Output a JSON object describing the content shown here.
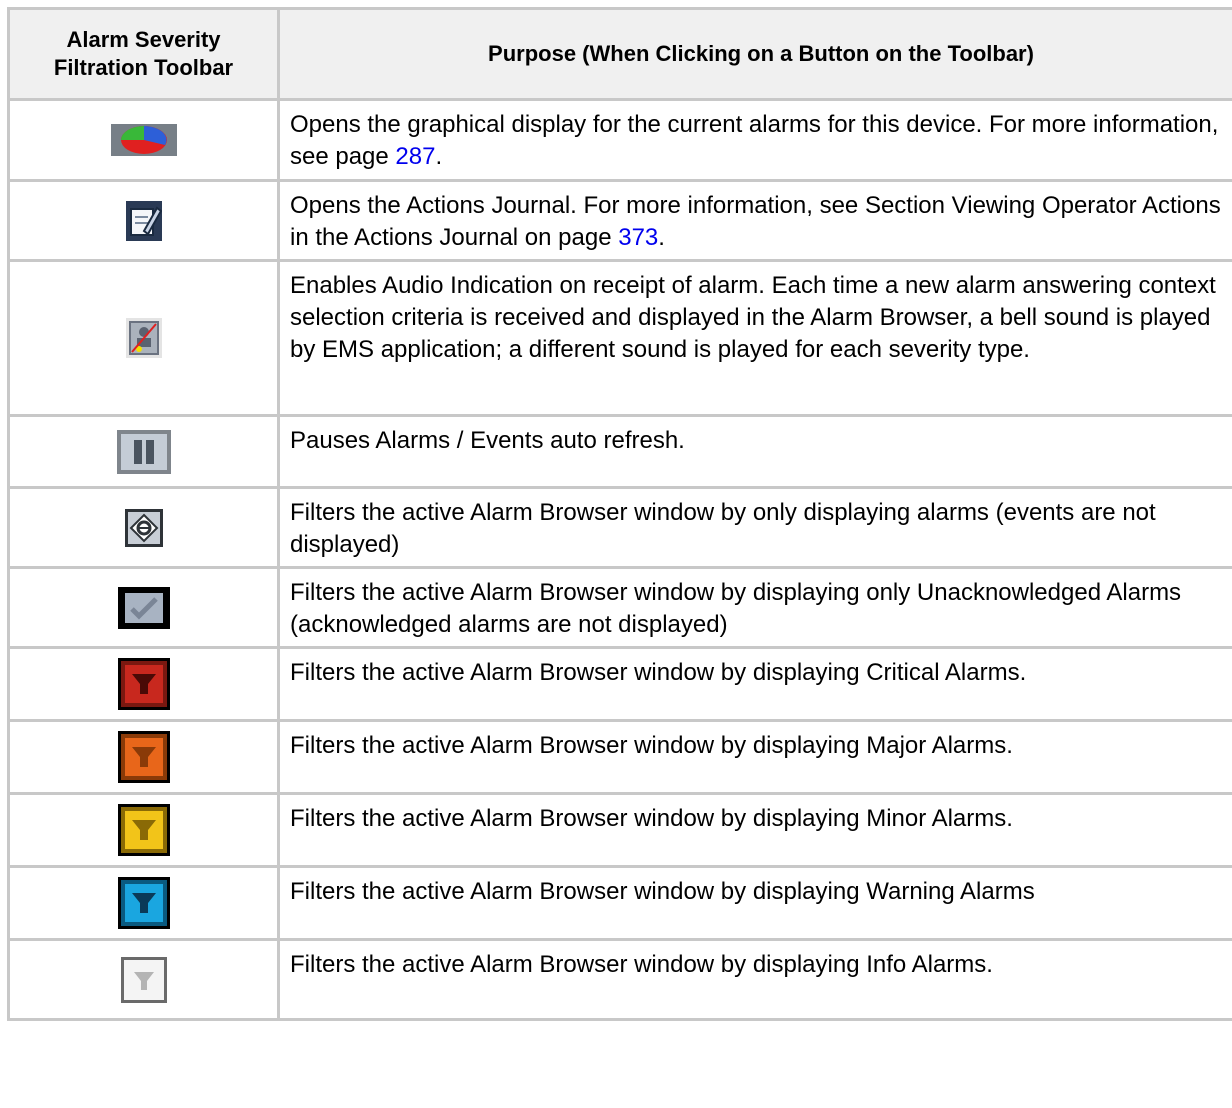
{
  "table": {
    "header": {
      "col1_line1": "Alarm Severity",
      "col1_line2": "Filtration Toolbar",
      "col2": "Purpose (When Clicking on a Button on the Toolbar)"
    },
    "rows": [
      {
        "icon": "pie-chart-icon",
        "text": "Opens the graphical display for the current alarms for this device. For more information, see page ",
        "link": "287",
        "after": "."
      },
      {
        "icon": "journal-edit-icon",
        "text": "Opens the Actions Journal. For more information, see Section Viewing Operator Actions in the Actions Journal on page ",
        "link": "373",
        "after": "."
      },
      {
        "icon": "audio-indication-off-icon",
        "text": "Enables Audio Indication on receipt of alarm. Each time a new alarm answering context selection criteria is received and displayed in the Alarm Browser, a bell sound is played by EMS application; a different sound is played for each severity type."
      },
      {
        "icon": "pause-icon",
        "text": "Pauses Alarms / Events auto refresh."
      },
      {
        "icon": "alarms-only-filter-icon",
        "text": "Filters the active Alarm Browser window by only displaying alarms (events are not displayed)"
      },
      {
        "icon": "unacknowledged-check-icon",
        "text": "Filters the active Alarm Browser window by displaying only Unacknowledged Alarms (acknowledged alarms are not displayed)"
      },
      {
        "icon": "critical-filter-icon",
        "text": "Filters the active Alarm Browser window by displaying Critical Alarms."
      },
      {
        "icon": "major-filter-icon",
        "text": "Filters the active Alarm Browser window by displaying Major Alarms."
      },
      {
        "icon": "minor-filter-icon",
        "text": "Filters the active Alarm Browser window by displaying Minor Alarms."
      },
      {
        "icon": "warning-filter-icon",
        "text": "Filters the active Alarm Browser window by displaying Warning Alarms"
      },
      {
        "icon": "info-filter-icon",
        "text": "Filters the active Alarm Browser window by displaying Info Alarms."
      }
    ]
  },
  "colors": {
    "critical": "#c8281e",
    "major": "#e8661a",
    "minor": "#f2c419",
    "warning": "#1aa6e0",
    "info": "#e8e8e8",
    "link": "#0000ee",
    "border": "#c8c8c8",
    "header_bg": "#f0f0f0"
  }
}
